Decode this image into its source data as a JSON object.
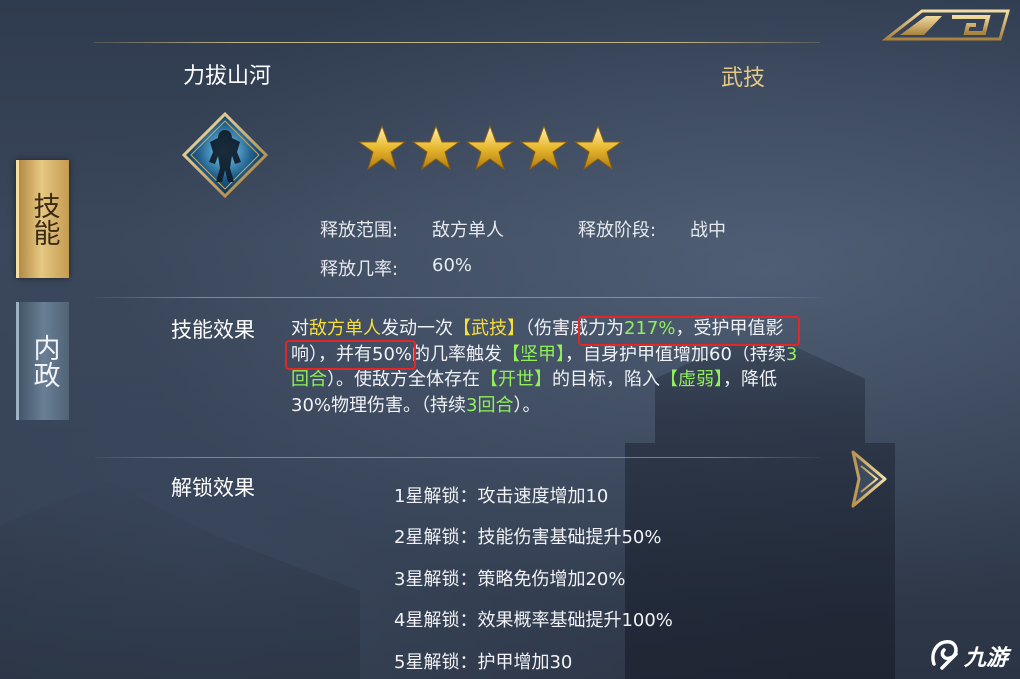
{
  "tabs": [
    {
      "label": "技能",
      "active": true
    },
    {
      "label": "内政",
      "active": false
    }
  ],
  "skill": {
    "name": "力拔山河",
    "type": "武技",
    "star_count": 5,
    "range_label": "释放范围:",
    "range_value": "敌方单人",
    "phase_label": "释放阶段:",
    "phase_value": "战中",
    "rate_label": "释放几率:",
    "rate_value": "60%"
  },
  "effect": {
    "label": "技能效果",
    "segments": [
      {
        "text": "对",
        "style": ""
      },
      {
        "text": "敌方单人",
        "style": "y"
      },
      {
        "text": "发动一次",
        "style": ""
      },
      {
        "text": "【武技】",
        "style": "y"
      },
      {
        "text": "（伤害威力为",
        "style": ""
      },
      {
        "text": "217%",
        "style": "g"
      },
      {
        "text": "，受护甲值影响），并有50%的几率触发",
        "style": ""
      },
      {
        "text": "【坚甲】",
        "style": "g"
      },
      {
        "text": "，自身护甲值增加60（持续",
        "style": ""
      },
      {
        "text": "3回合",
        "style": "g"
      },
      {
        "text": "）。使敌方全体存在",
        "style": ""
      },
      {
        "text": "【开世】",
        "style": "g"
      },
      {
        "text": "的目标，陷入",
        "style": ""
      },
      {
        "text": "【虚弱】",
        "style": "g"
      },
      {
        "text": "，降低30%物理伤害。（持续",
        "style": ""
      },
      {
        "text": "3回合",
        "style": "g"
      },
      {
        "text": "）。",
        "style": ""
      }
    ]
  },
  "unlock": {
    "label": "解锁效果",
    "items": [
      "1星解锁：攻击速度增加10",
      "2星解锁：技能伤害基础提升50%",
      "3星解锁：策略免伤增加20%",
      "4星解锁：效果概率基础提升100%",
      "5星解锁：护甲增加30"
    ]
  },
  "watermark": "九游",
  "colors": {
    "gold": "#e4c886",
    "highlight_yellow": "#f7df3a",
    "highlight_green": "#8ff05a",
    "annotation_red": "#e32626"
  }
}
